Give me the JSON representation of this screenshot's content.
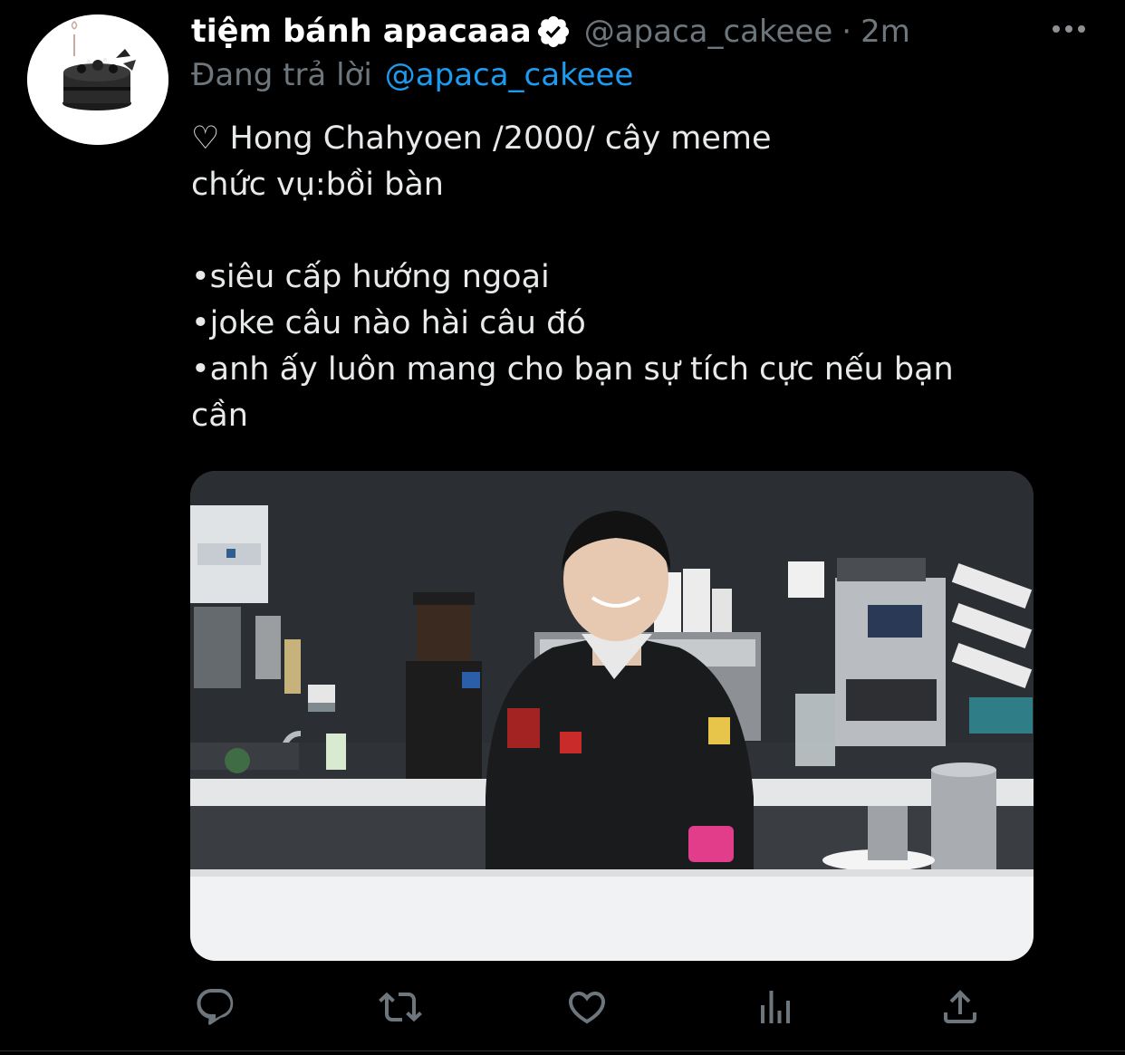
{
  "tweet": {
    "author": {
      "display_name": "tiệm bánh apacaaa",
      "handle": "@apaca_cakeee",
      "avatar_icon": "cake-avatar",
      "verified_icon": "verified-badge-icon"
    },
    "separator": "·",
    "timestamp": "2m",
    "reply": {
      "prefix": "Đang trả lời",
      "mention": "@apaca_cakeee"
    },
    "body_lines": [
      "♡ Hong Chahyoen /2000/ cây meme",
      "chức vụ:bồi bàn",
      "",
      "•siêu cấp hướng ngoại",
      "•joke câu nào hài câu đó",
      "•anh ấy luôn mang cho bạn sự tích cực nếu bạn",
      "cần"
    ],
    "media": {
      "type": "photo",
      "image_icon": "barista-photo"
    },
    "actions": [
      {
        "name": "reply",
        "icon": "reply-icon"
      },
      {
        "name": "retweet",
        "icon": "retweet-icon"
      },
      {
        "name": "like",
        "icon": "heart-icon"
      },
      {
        "name": "analytics",
        "icon": "analytics-icon"
      },
      {
        "name": "share",
        "icon": "share-icon"
      }
    ],
    "more_icon": "more-icon"
  },
  "colors": {
    "background": "#000000",
    "text_primary": "#e7e9ea",
    "text_secondary": "#6e767d",
    "accent": "#1d9bf0",
    "icon": "#6e767d"
  }
}
